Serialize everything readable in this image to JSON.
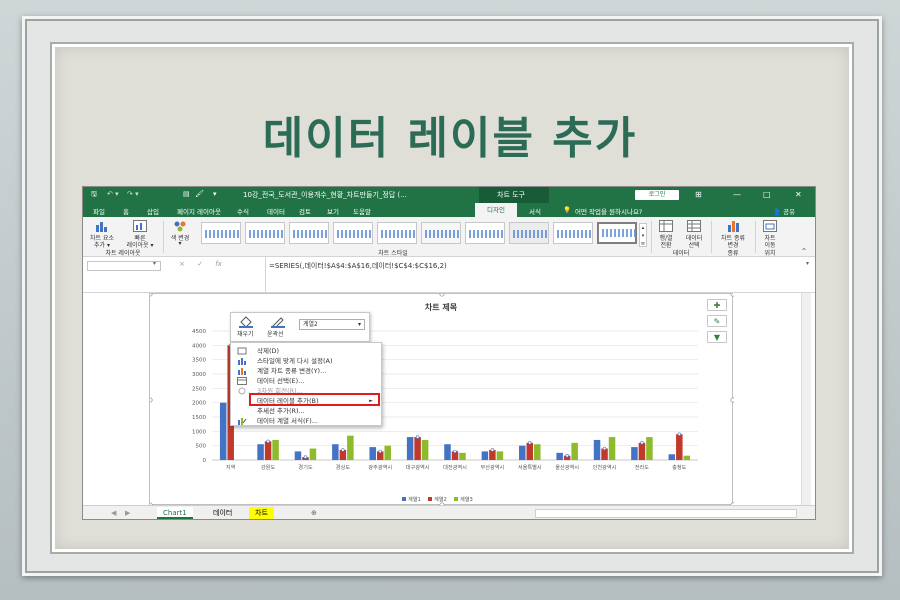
{
  "slide": {
    "title": "데이터 레이블 추가"
  },
  "window": {
    "quick_access": "",
    "filename": "10강_전국_도서관_이용개수_현황_차트만들기_정답 (...",
    "context_tools": "차트 도구",
    "login": "로그인",
    "win_controls": [
      "⊞",
      "—",
      "□",
      "✕"
    ]
  },
  "tabs": [
    "파일",
    "홈",
    "삽입",
    "페이지 레이아웃",
    "수식",
    "데이터",
    "검토",
    "보기",
    "도움말",
    "디자인",
    "서식"
  ],
  "active_tab": "디자인",
  "tell_me": "어떤 작업을 원하시나요?",
  "share": "공유",
  "ribbon": {
    "add_element": [
      "차트 요소",
      "추가 ▾"
    ],
    "quick_layout": [
      "빠른",
      "레이아웃 ▾"
    ],
    "change_colors": [
      "색 변경",
      "▾"
    ],
    "group_layout": "차트 레이아웃",
    "group_styles": "차트 스타일",
    "switch_row_col": [
      "행/열",
      "전환"
    ],
    "select_data": [
      "데이터",
      "선택"
    ],
    "group_data": "데이터",
    "change_type": [
      "차트 종류",
      "변경"
    ],
    "group_type": "종류",
    "move_chart": [
      "차트",
      "이동"
    ],
    "group_location": "위치"
  },
  "formula": {
    "name_box": "",
    "buttons": [
      "×",
      "✓",
      "fx"
    ],
    "text": "=SERIES(,데이터!$A$4:$A$16,데이터!$C$4:$C$16,2)"
  },
  "chart": {
    "title": "차트 제목",
    "side_buttons": [
      "✚",
      "✎",
      "▼"
    ]
  },
  "chart_data": {
    "type": "bar",
    "title": "차트 제목",
    "categories": [
      "지역",
      "강원도",
      "경기도",
      "경상도",
      "광주광역시",
      "대구광역시",
      "대전광역시",
      "부산광역시",
      "서울특별시",
      "울산광역시",
      "인천광역시",
      "전라도",
      "충청도"
    ],
    "series": [
      {
        "name": "계열1",
        "color": "#4472c4",
        "values": [
          2000,
          550,
          300,
          550,
          450,
          800,
          550,
          300,
          500,
          250,
          700,
          450,
          200
        ]
      },
      {
        "name": "계열2",
        "color": "#c0392b",
        "values": [
          4000,
          650,
          100,
          350,
          300,
          800,
          300,
          350,
          600,
          150,
          400,
          600,
          900
        ]
      },
      {
        "name": "계열3",
        "color": "#8dbb2b",
        "values": [
          0,
          700,
          400,
          850,
          500,
          700,
          250,
          300,
          550,
          600,
          800,
          800,
          150
        ]
      }
    ],
    "yticks": [
      0,
      500,
      1000,
      1500,
      2000,
      2500,
      3000,
      3500,
      4000,
      4500
    ],
    "ylim": [
      0,
      4500
    ],
    "legend": "bottom",
    "grid": true
  },
  "mini_toolbar": {
    "fill": "채우기",
    "outline": "윤곽선",
    "series_select": "계열2"
  },
  "context_menu": [
    {
      "label": "삭제(D)",
      "disabled": false
    },
    {
      "label": "스타일에 맞게 다시 설정(A)",
      "disabled": false
    },
    {
      "label": "계열 차트 종류 변경(Y)...",
      "disabled": false
    },
    {
      "label": "데이터 선택(E)...",
      "disabled": false
    },
    {
      "label": "3차원 회전(R)...",
      "disabled": true
    },
    {
      "label": "데이터 레이블 추가(B)",
      "disabled": false,
      "submenu": "►"
    },
    {
      "label": "추세선 추가(R)...",
      "disabled": false
    },
    {
      "label": "데이터 계열 서식(F)...",
      "disabled": false
    }
  ],
  "sheets": [
    "Chart1",
    "데이터",
    "차트"
  ],
  "add_sheet": "⊕"
}
